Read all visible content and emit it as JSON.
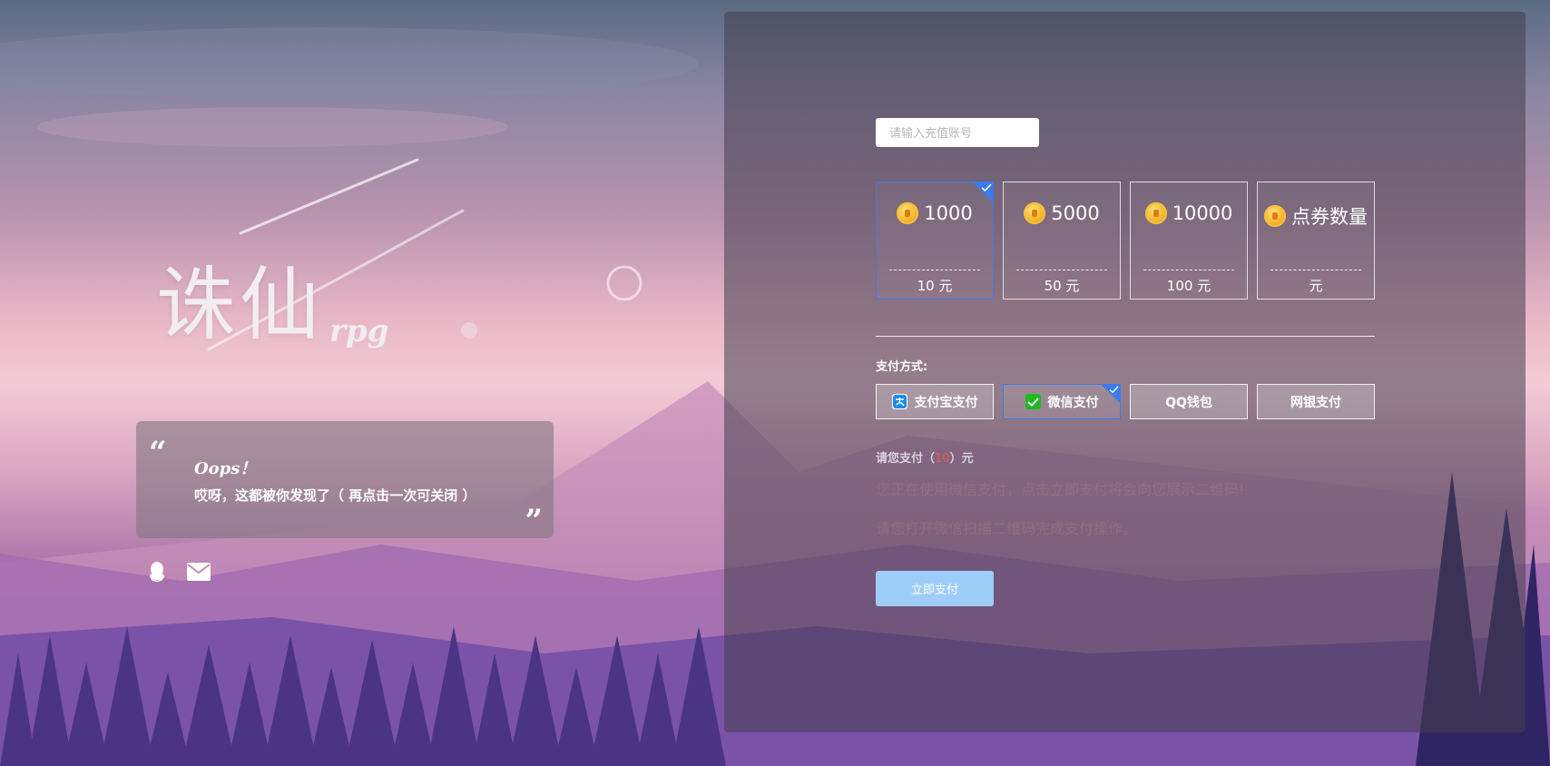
{
  "hero": {
    "title": "诛仙",
    "subtitle": "rpg",
    "quote_title": "Oops！",
    "quote_body": "哎呀，这都被你发现了（ 再点击一次可关闭 ）"
  },
  "social": {
    "icons": [
      "qq-icon",
      "mail-icon"
    ]
  },
  "form": {
    "account_placeholder": "请输入充值账号",
    "amounts": [
      {
        "value": "1000",
        "price": "10 元",
        "selected": true
      },
      {
        "value": "5000",
        "price": "50 元",
        "selected": false
      },
      {
        "value": "10000",
        "price": "100 元",
        "selected": false
      },
      {
        "value": "点券数量",
        "price": "元",
        "selected": false
      }
    ],
    "pay_label": "支付方式:",
    "methods": [
      {
        "label": "支付宝支付",
        "icon": "alipay-icon",
        "selected": false
      },
      {
        "label": "微信支付",
        "icon": "wechat-icon",
        "selected": true
      },
      {
        "label": "QQ钱包",
        "icon": "",
        "selected": false
      },
      {
        "label": "网银支付",
        "icon": "",
        "selected": false
      }
    ],
    "due_prefix": "请您支付（",
    "due_amount": "10",
    "due_suffix": "）元",
    "hint_line1": "您正在使用微信支付，点击立即支付将会向您展示二维码!",
    "hint_line2": "请您打开微信扫描二维码完成支付操作。",
    "submit_label": "立即支付"
  },
  "colors": {
    "accent": "#3b7bea",
    "button": "#9fcdf9",
    "amount_red": "#e85a4f"
  }
}
